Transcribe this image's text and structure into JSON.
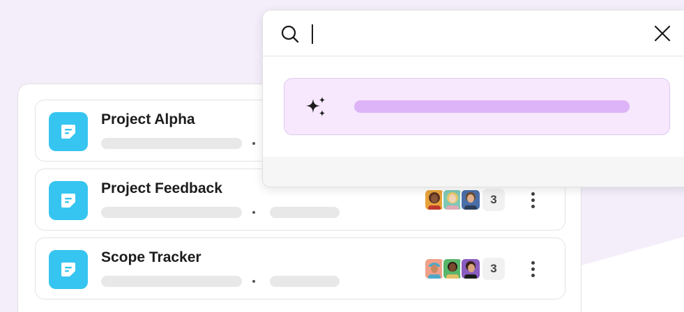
{
  "colors": {
    "background": "#f4eefb",
    "accent_icon": "#36c5f0",
    "ai_card": "#f7e8fd",
    "ai_bar": "#deb4f8"
  },
  "search": {
    "value": "",
    "icons": [
      "search-icon",
      "close-icon",
      "sparkle-icon"
    ]
  },
  "list": {
    "rows": [
      {
        "title": "Project Alpha",
        "icon": "canvas-doc-icon",
        "member_count": null
      },
      {
        "title": "Project Feedback",
        "icon": "canvas-doc-icon",
        "member_count": "3"
      },
      {
        "title": "Scope Tracker",
        "icon": "canvas-doc-icon",
        "member_count": "3"
      }
    ]
  }
}
